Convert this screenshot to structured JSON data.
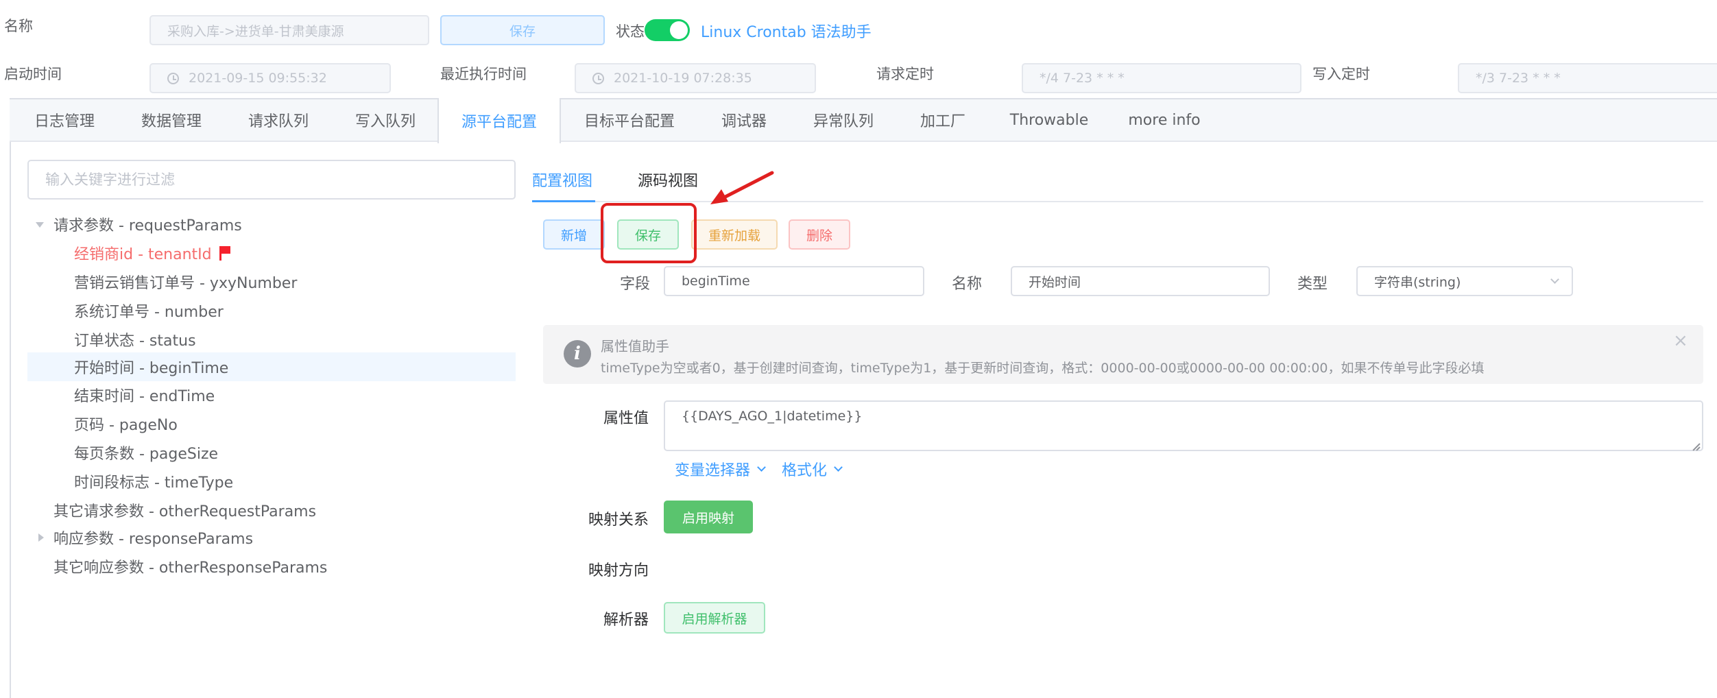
{
  "header": {
    "name_label": "名称",
    "name_value": "采购入库->进货单-甘肃美康源",
    "save_button": "保存",
    "status_label": "状态",
    "status_on": true,
    "crontab_link": "Linux Crontab 语法助手",
    "start_time_label": "启动时间",
    "start_time_value": "2021-09-15 09:55:32",
    "last_exec_label": "最近执行时间",
    "last_exec_value": "2021-10-19 07:28:35",
    "request_cron_label": "请求定时",
    "request_cron_value": "*/4 7-23 * * *",
    "write_cron_label": "写入定时",
    "write_cron_value": "*/3 7-23 * * *"
  },
  "tabs": [
    {
      "label": "日志管理"
    },
    {
      "label": "数据管理"
    },
    {
      "label": "请求队列"
    },
    {
      "label": "写入队列"
    },
    {
      "label": "源平台配置",
      "active": true
    },
    {
      "label": "目标平台配置"
    },
    {
      "label": "调试器"
    },
    {
      "label": "异常队列"
    },
    {
      "label": "加工厂"
    },
    {
      "label": "Throwable"
    },
    {
      "label": "more info"
    }
  ],
  "filter": {
    "placeholder": "输入关键字进行过滤"
  },
  "tree": {
    "request_params": "请求参数 - requestParams",
    "children": [
      {
        "label": "经销商id - tenantId",
        "flagged": true
      },
      {
        "label": "营销云销售订单号 - yxyNumber"
      },
      {
        "label": "系统订单号 - number"
      },
      {
        "label": "订单状态 - status"
      },
      {
        "label": "开始时间 - beginTime",
        "selected": true
      },
      {
        "label": "结束时间 - endTime"
      },
      {
        "label": "页码 - pageNo"
      },
      {
        "label": "每页条数 - pageSize"
      },
      {
        "label": "时间段标志 - timeType"
      }
    ],
    "other_request": "其它请求参数 - otherRequestParams",
    "response_params": "响应参数 - responseParams",
    "other_response": "其它响应参数 - otherResponseParams"
  },
  "subtabs": {
    "config_view": "配置视图",
    "source_view": "源码视图"
  },
  "actions": {
    "add": "新增",
    "save": "保存",
    "reload": "重新加载",
    "delete": "删除"
  },
  "form": {
    "field_label": "字段",
    "field_value": "beginTime",
    "name_label": "名称",
    "name_value": "开始时间",
    "type_label": "类型",
    "type_value": "字符串(string)",
    "alert_title": "属性值助手",
    "alert_text": "timeType为空或者0，基于创建时间查询，timeType为1，基于更新时间查询，格式：0000-00-00或0000-00-00 00:00:00，如果不传单号此字段必填",
    "value_label": "属性值",
    "value_text": "{{DAYS_AGO_1|datetime}}",
    "var_selector": "变量选择器",
    "formatter": "格式化",
    "mapping_label": "映射关系",
    "mapping_button": "启用映射",
    "direction_label": "映射方向",
    "parser_label": "解析器",
    "parser_button": "启用解析器"
  },
  "colors": {
    "primary": "#409eff",
    "success": "#13ce66",
    "danger": "#f56c6c",
    "warning": "#e6a23c",
    "annotation_red": "#e02020"
  }
}
